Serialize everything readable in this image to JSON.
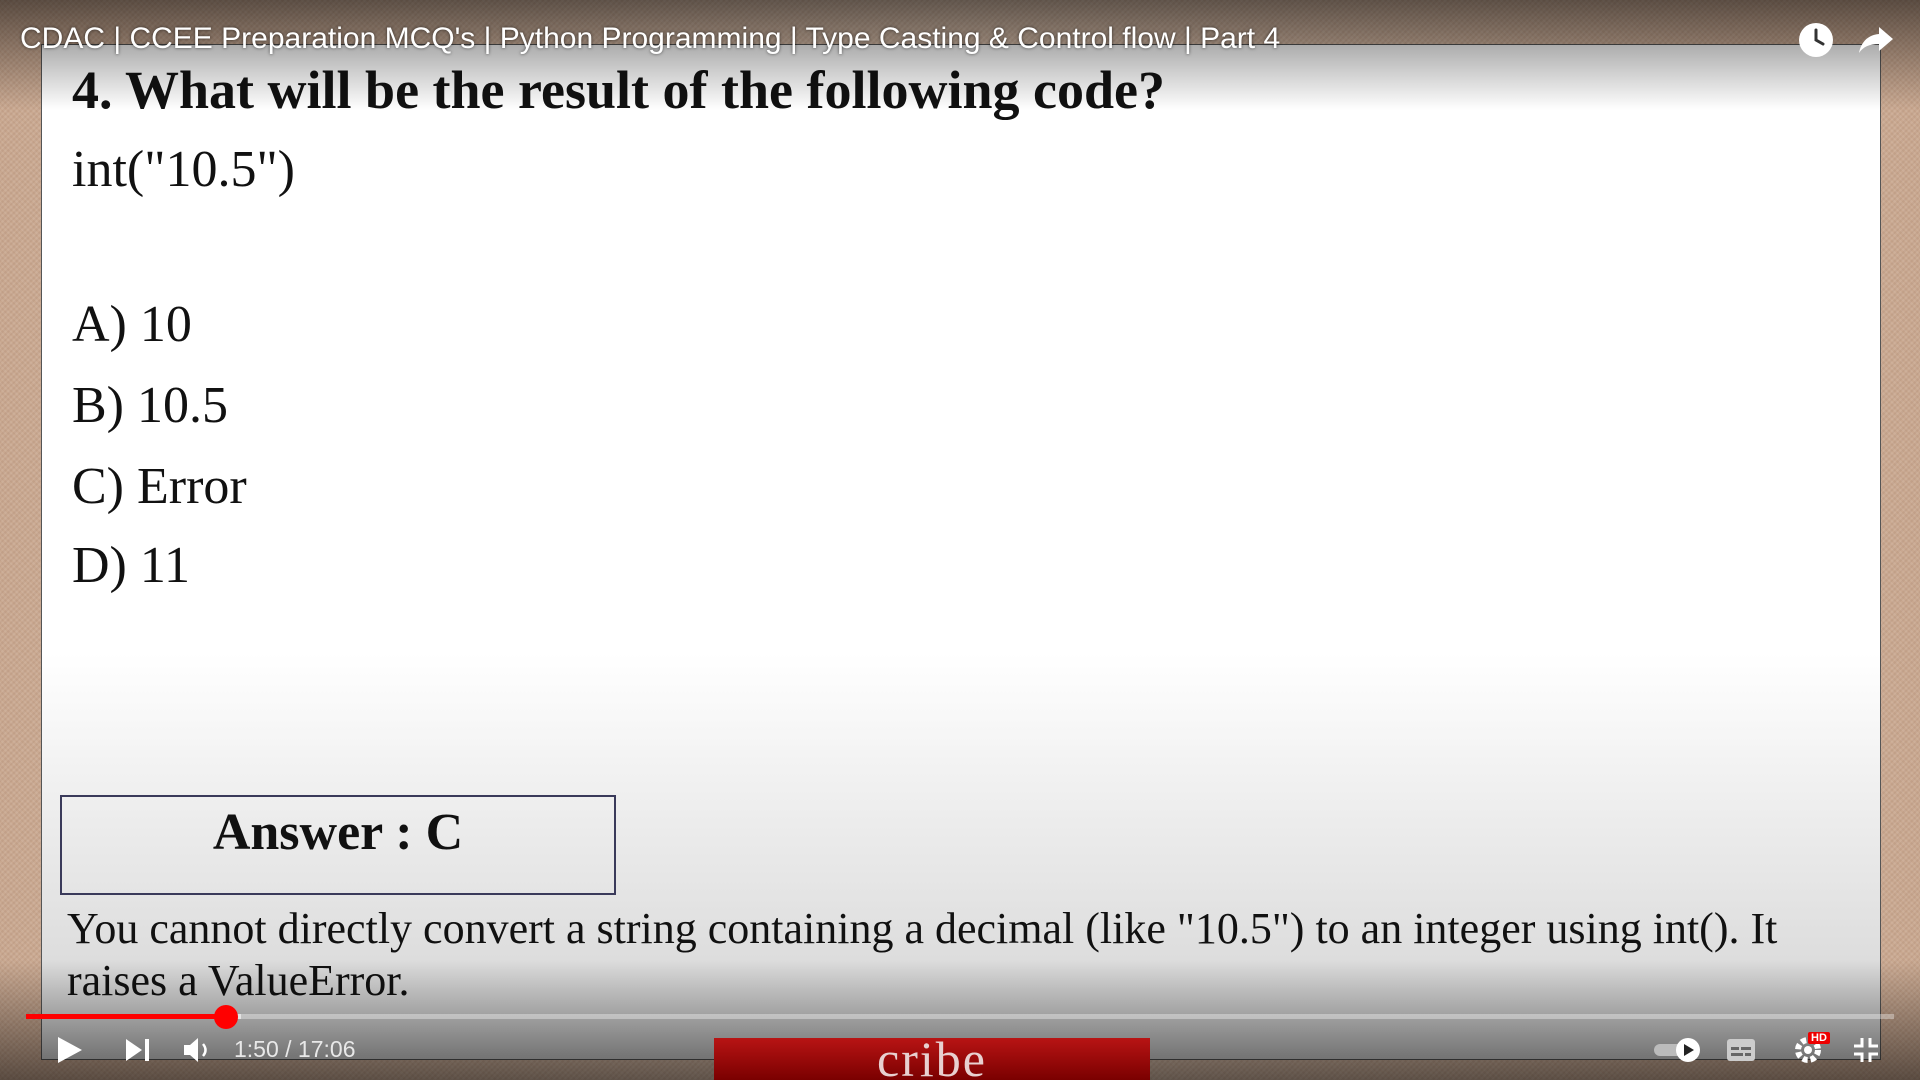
{
  "video": {
    "title": "CDAC | CCEE Preparation MCQ's | Python Programming | Type Casting & Control flow | Part 4",
    "time_display": "1:50 / 17:06",
    "progress_fraction": 0.107,
    "buffered_fraction": 0.115,
    "subscribe_overlay_text": "cribe",
    "hd_badge": "HD",
    "accent_color": "#ff0000"
  },
  "slide": {
    "question": "4. What will be the result of  the following code?",
    "code": "int(\"10.5\")",
    "options": [
      "A) 10",
      "B) 10.5",
      "C) Error",
      "D) 11"
    ],
    "answer": "Answer : C",
    "explanation": "You cannot directly convert a string containing a decimal (like \"10.5\") to an integer using int(). It raises a ValueError."
  },
  "icons": {
    "watch_later": "clock-icon",
    "share": "share-arrow-icon",
    "play": "play-icon",
    "next": "next-icon",
    "volume": "volume-icon",
    "autoplay": "autoplay-toggle-icon",
    "captions": "captions-icon",
    "settings": "gear-icon",
    "fullscreen": "exit-fullscreen-icon"
  }
}
